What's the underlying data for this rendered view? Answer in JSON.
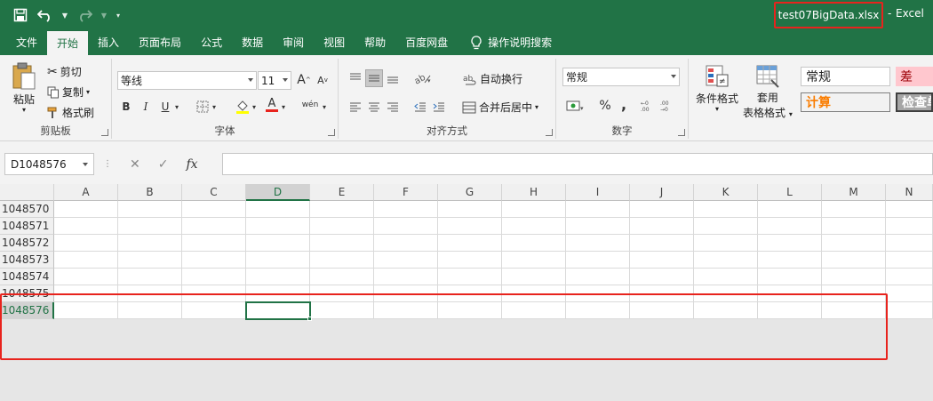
{
  "titlebar": {
    "filename": "test07BigData.xlsx",
    "separator": "-",
    "app": "Excel"
  },
  "tabs": [
    {
      "label": "文件",
      "active": false
    },
    {
      "label": "开始",
      "active": true
    },
    {
      "label": "插入",
      "active": false
    },
    {
      "label": "页面布局",
      "active": false
    },
    {
      "label": "公式",
      "active": false
    },
    {
      "label": "数据",
      "active": false
    },
    {
      "label": "审阅",
      "active": false
    },
    {
      "label": "视图",
      "active": false
    },
    {
      "label": "帮助",
      "active": false
    },
    {
      "label": "百度网盘",
      "active": false
    }
  ],
  "tell_me": "操作说明搜索",
  "ribbon": {
    "clipboard": {
      "paste": "粘贴",
      "cut": "剪切",
      "copy": "复制",
      "format_painter": "格式刷",
      "label": "剪贴板"
    },
    "font": {
      "font_name": "等线",
      "font_size": "11",
      "bold": "B",
      "italic": "I",
      "underline": "U",
      "increase": "A",
      "decrease": "A",
      "font_color": "A",
      "phonetic": "wén",
      "label": "字体"
    },
    "alignment": {
      "wrap_text": "自动换行",
      "merge_center": "合并后居中",
      "label": "对齐方式"
    },
    "number": {
      "format": "常规",
      "percent": "%",
      "comma": ",",
      "label": "数字"
    },
    "styles": {
      "conditional": "条件格式",
      "table_format_1": "套用",
      "table_format_2": "表格格式",
      "normal": "常规",
      "bad": "差",
      "calc": "计算",
      "check": "检查单"
    }
  },
  "formula_bar": {
    "name_box": "D1048576",
    "fx": "fx",
    "value": ""
  },
  "grid": {
    "columns": [
      "A",
      "B",
      "C",
      "D",
      "E",
      "F",
      "G",
      "H",
      "I",
      "J",
      "K",
      "L",
      "M",
      "N"
    ],
    "active_column": "D",
    "rows": [
      "1048570",
      "1048571",
      "1048572",
      "1048573",
      "1048574",
      "1048575",
      "1048576"
    ],
    "active_row": "1048576"
  },
  "colors": {
    "accent": "#217346",
    "highlight": "#e8231d"
  }
}
